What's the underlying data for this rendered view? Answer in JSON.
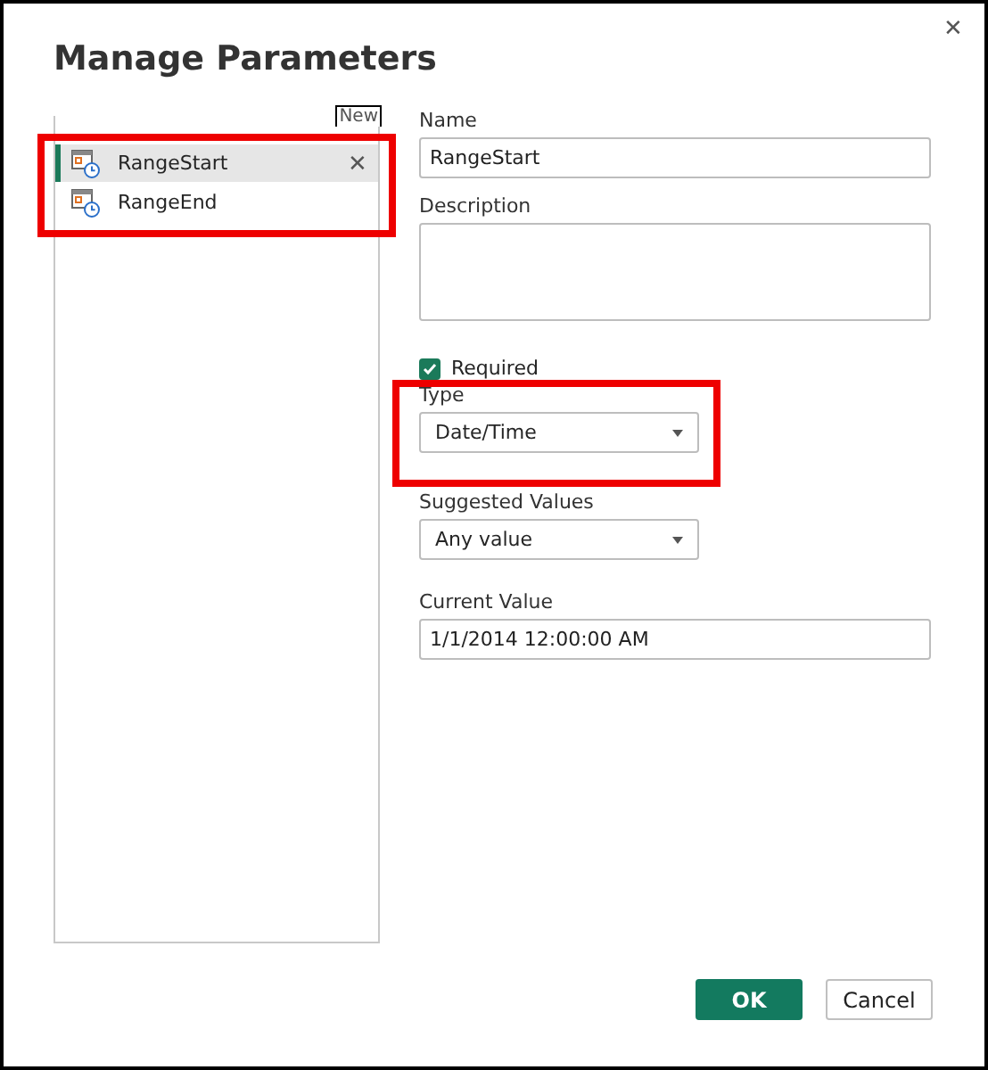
{
  "window": {
    "title": "Manage Parameters",
    "close": "✕"
  },
  "new_link": "New",
  "parameters": [
    {
      "name": "RangeStart",
      "selected": true,
      "remove": "✕"
    },
    {
      "name": "RangeEnd",
      "selected": false
    }
  ],
  "form": {
    "name_label": "Name",
    "name_value": "RangeStart",
    "description_label": "Description",
    "required": {
      "label": "Required",
      "checked": true
    },
    "type_label": "Type",
    "type_value": "Date/Time",
    "suggested_label": "Suggested Values",
    "suggested_value": "Any value",
    "current_label": "Current Value",
    "current_value": "1/1/2014 12:00:00 AM"
  },
  "buttons": [
    {
      "label": "OK",
      "kind": "primary"
    },
    {
      "label": "Cancel",
      "kind": "secondary"
    }
  ]
}
